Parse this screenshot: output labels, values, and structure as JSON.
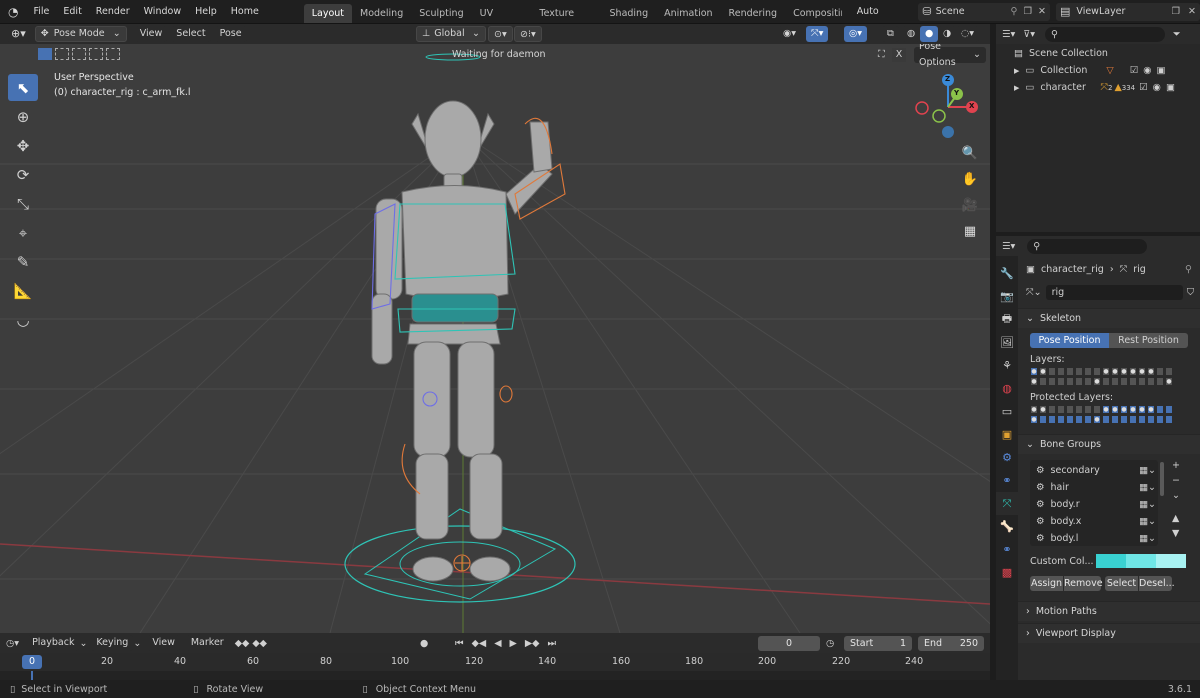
{
  "topbar": {
    "menus": [
      "File",
      "Edit",
      "Render",
      "Window",
      "Help",
      "Home Builder"
    ],
    "workspaces": [
      "Layout",
      "Modeling",
      "Sculpting",
      "UV Editing",
      "Texture Paint",
      "Shading",
      "Animation",
      "Rendering",
      "Compositir"
    ],
    "active_workspace": "Layout",
    "auto_reload": "Auto Reload",
    "scene": "Scene",
    "view_layer": "ViewLayer"
  },
  "viewport_header": {
    "mode": "Pose Mode",
    "menus": [
      "View",
      "Select",
      "Pose"
    ],
    "orientation": "Global",
    "status": "Waiting for daemon",
    "pose_options": "Pose Options",
    "x_button": "X"
  },
  "viewport": {
    "perspective": "User Perspective",
    "object_info": "(0) character_rig : c_arm_fk.l",
    "axes": {
      "z": "Z",
      "y": "Y",
      "x": "X"
    },
    "colors": {
      "x_axis": "#e0434f",
      "y_axis": "#8bc24a",
      "z_axis": "#3a8ad8",
      "floor": "#3d3d3d",
      "grid": "#4a4a4a"
    }
  },
  "outliner": {
    "root": "Scene Collection",
    "items": [
      {
        "label": "Collection"
      },
      {
        "label": "character",
        "badge1": "2",
        "badge2": "334"
      }
    ]
  },
  "properties": {
    "breadcrumb_object": "character_rig",
    "breadcrumb_data": "rig",
    "data_name": "rig",
    "skeleton_title": "Skeleton",
    "pose_position": "Pose Position",
    "rest_position": "Rest Position",
    "layers_label": "Layers:",
    "protected_layers_label": "Protected Layers:",
    "bone_groups_title": "Bone Groups",
    "bone_groups": [
      "secondary",
      "hair",
      "body.r",
      "body.x",
      "body.l"
    ],
    "custom_color_label": "Custom Col...",
    "custom_colors": [
      "#39d2d2",
      "#6fe6e6",
      "#a8f2f2"
    ],
    "assign": "Assign",
    "remove": "Remove",
    "select": "Select",
    "deselect": "Desel...",
    "motion_paths": "Motion Paths",
    "viewport_display": "Viewport Display"
  },
  "timeline": {
    "menus": [
      "Playback",
      "Keying",
      "View",
      "Marker"
    ],
    "current_frame": "0",
    "start_label": "Start",
    "start_value": "1",
    "end_label": "End",
    "end_value": "250",
    "ruler": [
      "0",
      "20",
      "40",
      "60",
      "80",
      "100",
      "120",
      "140",
      "160",
      "180",
      "200",
      "220",
      "240"
    ]
  },
  "statusbar": {
    "left": "Select in Viewport",
    "middle": "Rotate View",
    "right": "Object Context Menu",
    "version": "3.6.1"
  }
}
